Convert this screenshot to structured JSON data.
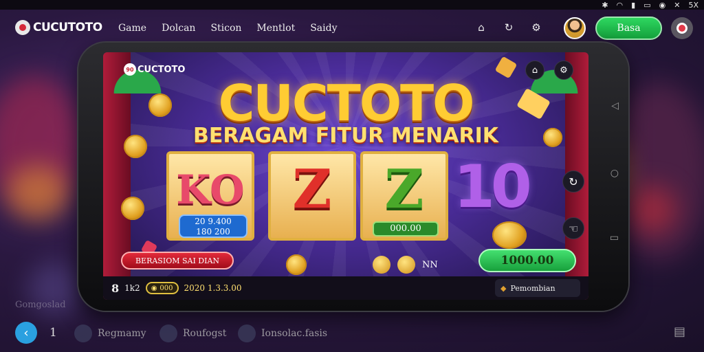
{
  "status": {
    "icons": [
      "bluetooth-icon",
      "wifi-icon",
      "signal-icon",
      "battery-icon",
      "alarm-icon",
      "close-icon"
    ],
    "clock": "5X"
  },
  "header": {
    "brand": "CUCUTOTO",
    "nav": [
      "Game",
      "Dolcan",
      "Sticon",
      "Mentlot",
      "Saidy"
    ],
    "icons": [
      "home-icon",
      "refresh-icon",
      "settings-icon"
    ],
    "login_label": "Basa"
  },
  "game": {
    "inner_brand": "CUCTOTO",
    "inner_mark": "90",
    "title": "CUCTOTO",
    "subtitle": "BERAGAM FITUR MENARIK",
    "reels": [
      {
        "symbol": "KO",
        "lines": [
          "20 9.400",
          "180 200"
        ]
      },
      {
        "symbol": "Z"
      },
      {
        "symbol": "Z",
        "amount": "000.00"
      },
      {
        "symbol": "10"
      }
    ],
    "red_button": "BERASIOM SAI DIAN",
    "mini_label": "NN",
    "win_amount": "1000.00",
    "side_icons": [
      "refresh-icon",
      "home-icon",
      "tab-icon"
    ],
    "top_icons": [
      "home-icon",
      "settings-icon"
    ]
  },
  "bottom_bar": {
    "level": "8",
    "level_label": "1k2",
    "chip_label": "000",
    "balance": "2020 1.3.3.00",
    "right_label": "Pemombian"
  },
  "footer": {
    "section_label": "Gomgoslad",
    "page_num": "1",
    "items": [
      "Regmamy",
      "Roufogst",
      "Ionsolac.fasis"
    ],
    "icon": "menu-icon"
  },
  "colors": {
    "accent_green": "#1fc24a",
    "accent_red": "#d42a3a",
    "title_gold": "#ffcc33",
    "back_blue": "#2aa0e0"
  }
}
